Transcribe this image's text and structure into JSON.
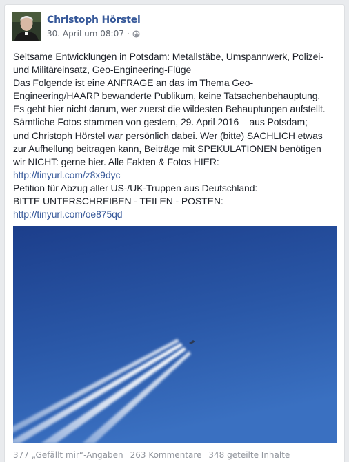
{
  "post": {
    "author": "Christoph Hörstel",
    "timestamp": "30. April um 08:07",
    "meta_separator": "·",
    "privacy_icon": "globe-icon",
    "lines": [
      "Seltsame Entwicklungen in Potsdam: Metallstäbe, Umspannwerk, Polizei-",
      "und Militäreinsatz, Geo-Engineering-Flüge",
      "Das Folgende ist eine ANFRAGE an das im Thema Geo-",
      "Engineering/HAARP bewanderte Publikum, keine Tatsachenbehauptung.",
      "Es geht hier nicht darum, wer zuerst die wildesten Behauptungen aufstellt.",
      "Sämtliche Fotos stammen von gestern, 29. April 2016 – aus Potsdam;",
      "und Christoph Hörstel war persönlich dabei. Wer (bitte) SACHLICH etwas",
      "zur Aufhellung beitragen kann, Beiträge mit SPEKULATIONEN benötigen",
      "wir NICHT: gerne hier. Alle Fakten & Fotos HIER:"
    ],
    "link1": "http://tinyurl.com/z8x9dyc",
    "lines2": [
      "Petition für Abzug aller US-/UK-Truppen aus Deutschland:",
      "BITTE UNTERSCHREIBEN - TEILEN - POSTEN:"
    ],
    "link2": "http://tinyurl.com/oe875qd"
  },
  "stats": {
    "likes": "377 „Gefällt mir“-Angaben",
    "comments": "263 Kommentare",
    "shares": "348 geteilte Inhalte"
  },
  "colors": {
    "link": "#365899",
    "text": "#1d2129",
    "meta": "#616770",
    "sky_top": "#1c3e8b",
    "sky_bottom": "#3a70c1"
  }
}
